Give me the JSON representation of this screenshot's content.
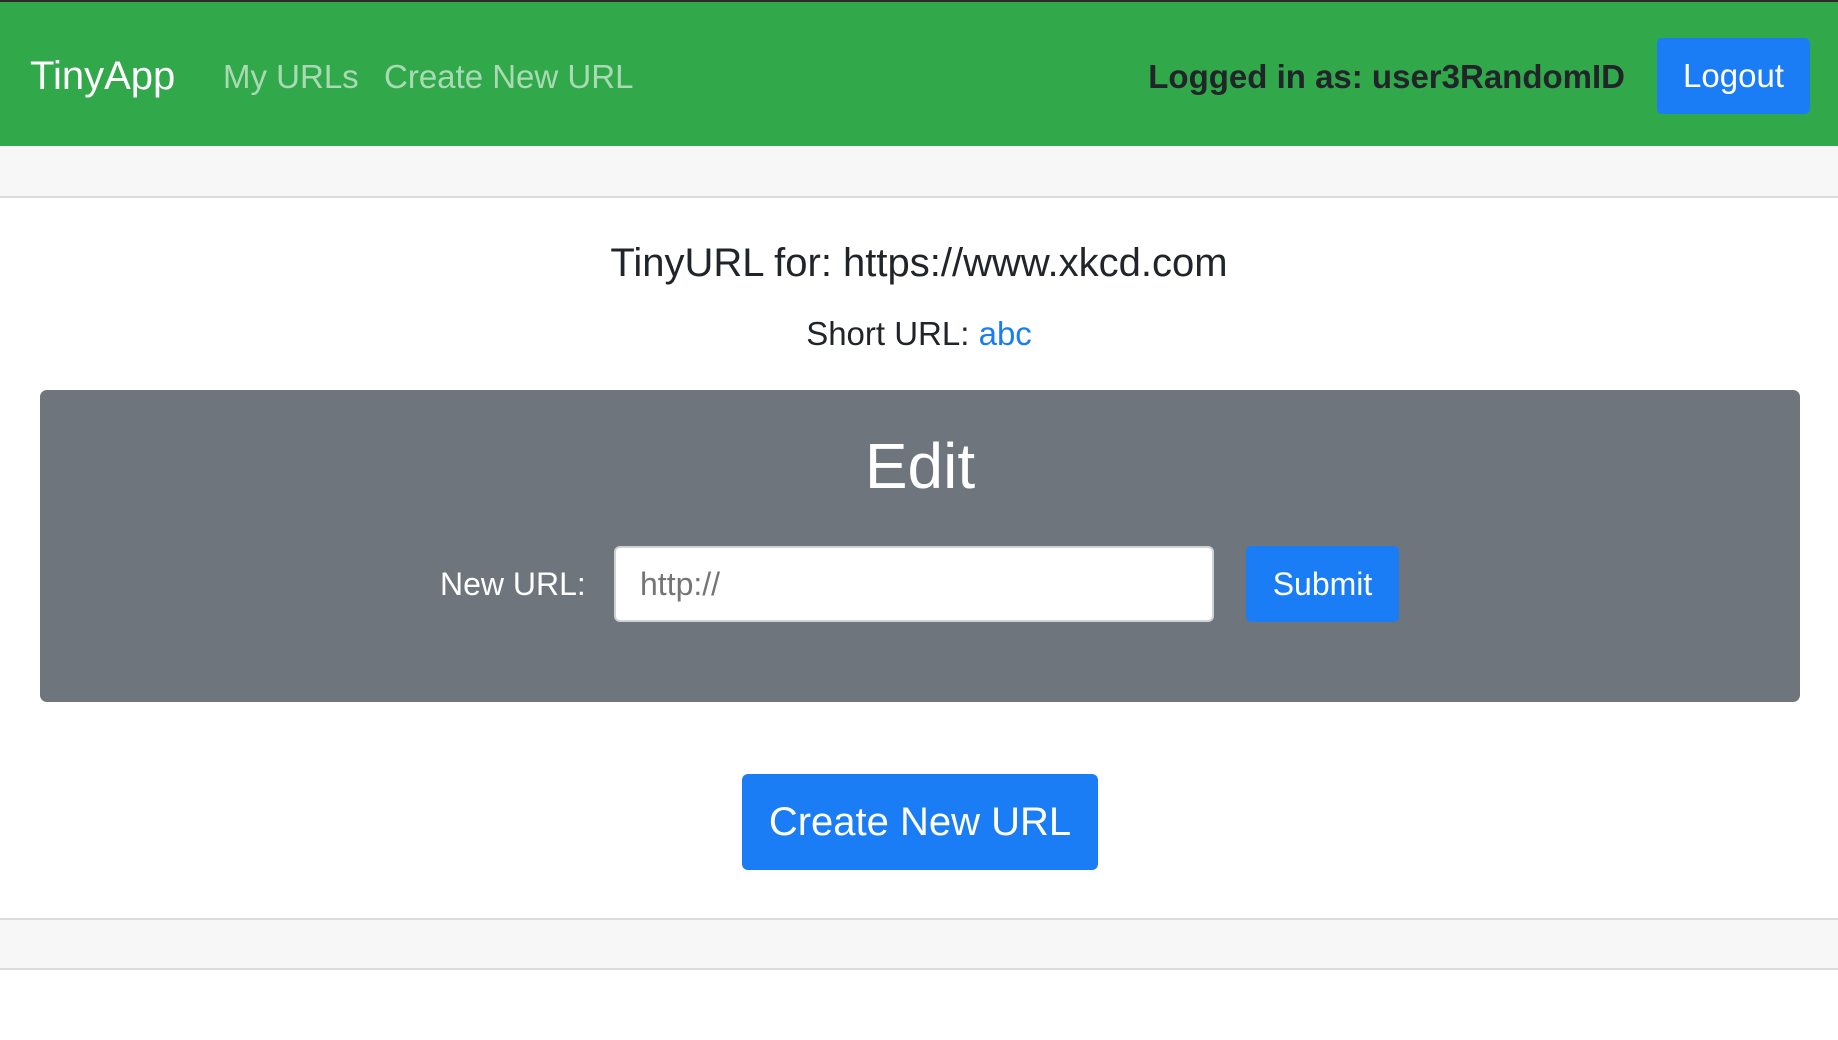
{
  "navbar": {
    "brand": "TinyApp",
    "links": [
      {
        "label": "My URLs"
      },
      {
        "label": "Create New URL"
      }
    ],
    "logged_in_text": "Logged in as: user3RandomID",
    "logout_label": "Logout"
  },
  "main": {
    "title": "TinyURL for: https://www.xkcd.com",
    "short_url_label": "Short URL: ",
    "short_url_value": "abc"
  },
  "edit": {
    "heading": "Edit",
    "field_label": "New URL:",
    "field_placeholder": "http://",
    "field_value": "",
    "submit_label": "Submit"
  },
  "create_button_label": "Create New URL",
  "colors": {
    "navbar_bg": "#31a84a",
    "primary": "#1a7df5",
    "card_bg": "#6e757d"
  }
}
